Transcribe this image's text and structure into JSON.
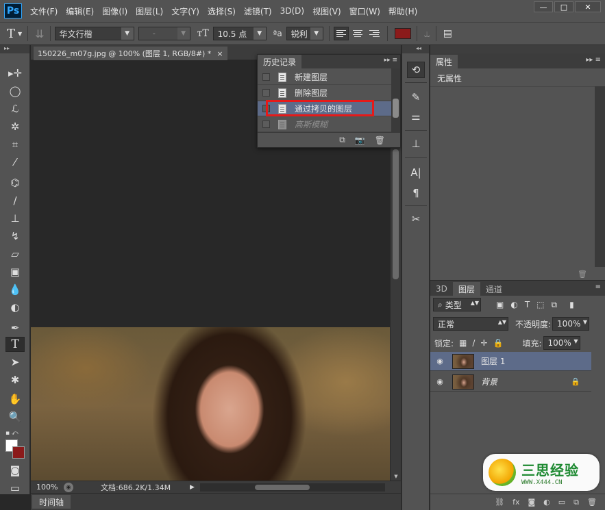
{
  "app": {
    "logo": "Ps",
    "menu": [
      "文件(F)",
      "编辑(E)",
      "图像(I)",
      "图层(L)",
      "文字(Y)",
      "选择(S)",
      "滤镜(T)",
      "3D(D)",
      "视图(V)",
      "窗口(W)",
      "帮助(H)"
    ],
    "window_buttons": [
      "—",
      "□",
      "✕"
    ]
  },
  "options": {
    "tool_glyph": "T",
    "font_family": "华文行楷",
    "font_style": "-",
    "font_size": "10.5 点",
    "aa_label": "ªa",
    "antialias": "锐利",
    "text_color": "#8b1a1a"
  },
  "document": {
    "tab_title": "150226_m07g.jpg @ 100% (图层 1, RGB/8#) *",
    "tab_close": "×",
    "zoom": "100%",
    "doc_size": "文档:686.2K/1.34M"
  },
  "timeline": {
    "label": "时间轴"
  },
  "history": {
    "title": "历史记录",
    "items": [
      {
        "label": "新建图层",
        "state": "normal"
      },
      {
        "label": "删除图层",
        "state": "normal"
      },
      {
        "label": "通过拷贝的图层",
        "state": "active"
      },
      {
        "label": "高斯模糊",
        "state": "dimmed"
      }
    ]
  },
  "properties": {
    "title": "属性",
    "empty_text": "无属性"
  },
  "layers": {
    "tabs": [
      "3D",
      "图层",
      "通道"
    ],
    "active_tab": "图层",
    "filter_kind": "类型",
    "blend_mode": "正常",
    "opacity_label": "不透明度:",
    "opacity_value": "100%",
    "lock_label": "锁定:",
    "fill_label": "填充:",
    "fill_value": "100%",
    "items": [
      {
        "name": "图层 1",
        "active": true,
        "locked": false
      },
      {
        "name": "背景",
        "active": false,
        "locked": true
      }
    ]
  },
  "watermark": {
    "main": "三思经验",
    "sub": "WWW.X444.CN"
  },
  "colors": {
    "foreground": "#ffffff",
    "background": "#8b1a1a",
    "selection": "#5d6b89",
    "highlight_box": "#e51a1a"
  },
  "icons": {
    "toolbar": [
      "move-icon",
      "marquee-icon",
      "lasso-icon",
      "magic-wand-icon",
      "crop-icon",
      "eyedropper-icon",
      "healing-brush-icon",
      "brush-icon",
      "clone-stamp-icon",
      "history-brush-icon",
      "eraser-icon",
      "gradient-icon",
      "blur-icon",
      "dodge-icon",
      "pen-icon",
      "type-icon",
      "path-selection-icon",
      "shape-icon",
      "hand-icon",
      "zoom-icon",
      "quick-mask-icon",
      "screen-mode-icon"
    ]
  }
}
